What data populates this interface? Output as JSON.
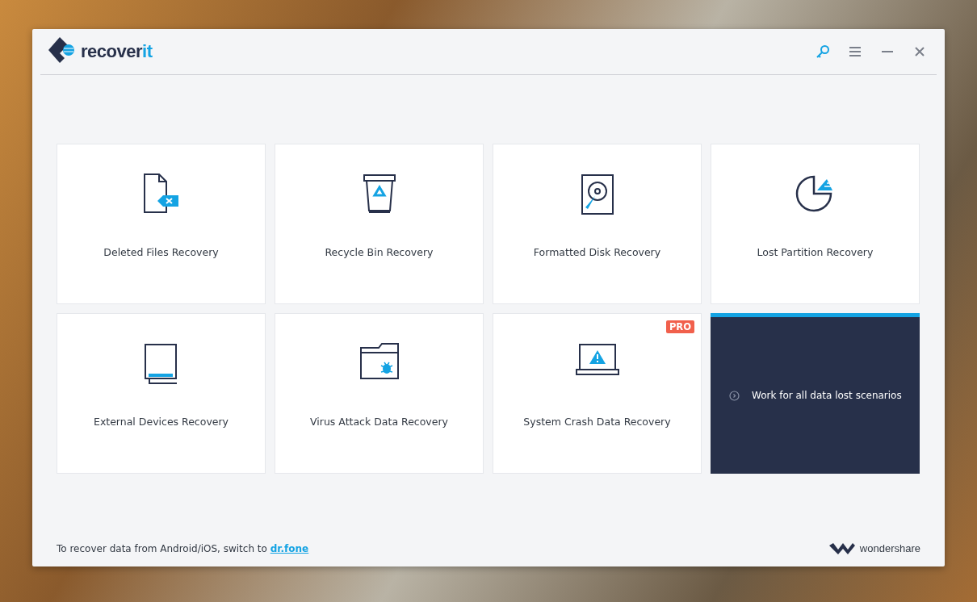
{
  "logo": {
    "name": "recover",
    "suffix": "it"
  },
  "cards": [
    {
      "kind": "scenario",
      "label": "Deleted Files Recovery"
    },
    {
      "kind": "scenario",
      "label": "Recycle Bin Recovery"
    },
    {
      "kind": "scenario",
      "label": "Formatted Disk Recovery"
    },
    {
      "kind": "scenario",
      "label": "Lost Partition Recovery"
    },
    {
      "kind": "scenario",
      "label": "External Devices Recovery"
    },
    {
      "kind": "scenario",
      "label": "Virus Attack Data Recovery"
    },
    {
      "kind": "scenario",
      "label": "System Crash Data Recovery",
      "badge": "PRO"
    },
    {
      "kind": "info",
      "label": "Work for all data lost scenarios"
    }
  ],
  "footer": {
    "text": "To recover data from Android/iOS, switch to",
    "link": "dr.fone",
    "brand": "wondershare"
  }
}
